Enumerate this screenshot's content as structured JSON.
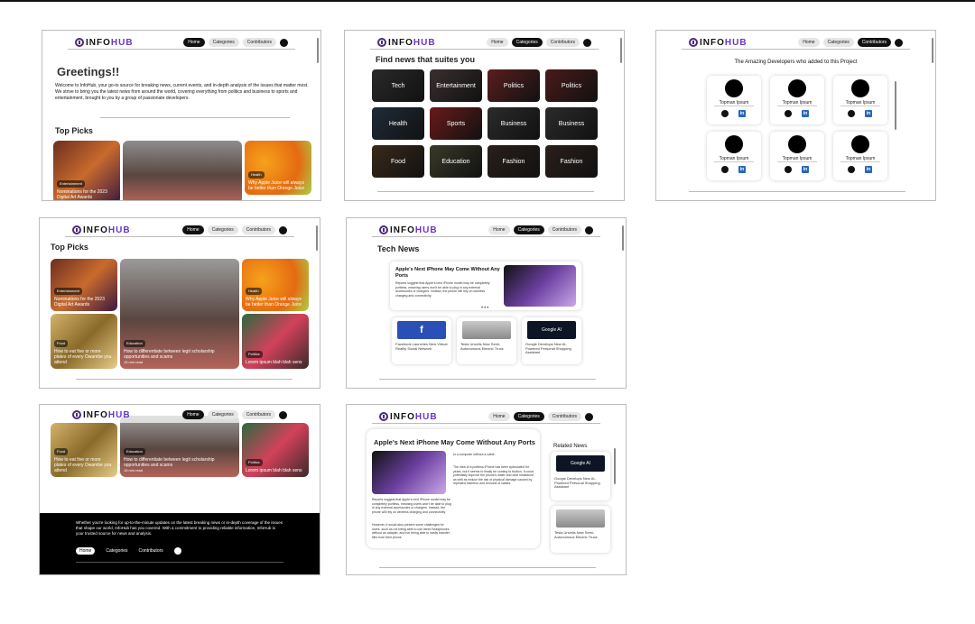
{
  "brand": {
    "info": "INFO",
    "hub": "HUB"
  },
  "nav": {
    "home": "Home",
    "categories": "Categories",
    "contributors": "Contributors"
  },
  "home": {
    "greeting": "Greetings!!",
    "intro": "Welcome to InfoHub, your go-to source for breaking news, current events, and in-depth analysis of the issues that matter most. We strive to bring you the latest news from around the world, covering everything from politics and business to sports and entertainment, brought to you by a group of passionate developers."
  },
  "top_picks": {
    "title": "Top Picks",
    "cards": [
      {
        "tag": "Entertainment",
        "title": "Nominations for the 2023 Digital Art Awards"
      },
      {
        "tag": "Health",
        "title": "Why Apple Juice will always be better than Orange Juice"
      },
      {
        "tag": "Food",
        "title": "How to eat five or more plates of every Owambe you attend"
      },
      {
        "tag": "Education",
        "title": "How to differentiate between legit scholarship opportunities and scams",
        "meta": "15 min read"
      },
      {
        "tag": "Politics",
        "title": "Lorem ipsum blah blah sens"
      }
    ]
  },
  "categories": {
    "title": "Find news that suites you",
    "items": [
      "Tech",
      "Entertainment",
      "Politics",
      "Politics",
      "Health",
      "Sports",
      "Business",
      "Business",
      "Food",
      "Education",
      "Fashion",
      "Fashion"
    ]
  },
  "contributors": {
    "title": "The Amazing Developers who added to this Project",
    "names": [
      "Topman Ipsum",
      "Topman Ipsum",
      "Topman Ipsum",
      "Topman Ipsum",
      "Topman Ipsum",
      "Topman Ipsum"
    ]
  },
  "tech": {
    "title": "Tech News",
    "featured_title": "Apple's Next iPhone May Come Without Any Ports",
    "featured_body": "Reports suggest that Apple's next iPhone model may be completely portless, meaning users won't be able to plug in any external accessories or chargers. Instead, the phone will rely on wireless charging and connectivity.",
    "cards": [
      {
        "label": "Facebook Launches New Virtual Reality Social Network",
        "thumb": "f"
      },
      {
        "label": "Tesla Unveils New Semi-Autonomous Electric Truck",
        "thumb": ""
      },
      {
        "label": "Google Develops New AI-Powered Personal Shopping Assistant",
        "thumb": "Google AI"
      }
    ]
  },
  "footer": {
    "text": "Whether you're looking for up-to-the-minute updates on the latest breaking news or in-depth coverage of the issues that shape our world, InfoHub has you covered. With a commitment to providing reliable information, InfoHub is your trusted source for news and analysis.",
    "links": [
      "Home",
      "Categories",
      "Contributors"
    ]
  },
  "article": {
    "title": "Apple's Next iPhone May Come Without Any Ports",
    "p1": "Reports suggest that Apple's next iPhone model may be completely portless, meaning users won't be able to plug in any external accessories or chargers. Instead, the phone will rely on wireless charging and connectivity.",
    "p2": "However, it would also present some challenges for users, such as not being able to use wired headphones without an adapter, and not being able to easily transfer files from their phone",
    "side1": "to a computer without a cable.",
    "side2": "The idea of a portless iPhone has been speculated for years, but it seems to finally be coming to fruition. It could potentially improve the phone's water and dust resistance, as well as reduce the risk of physical damage caused by repeated insertion and removal of cables.",
    "related_title": "Related News",
    "related": [
      {
        "label": "Google Develops New AI-Powered Personal Shopping Assistant",
        "thumb": "Google AI"
      },
      {
        "label": "Tesla Unveils New Semi-Autonomous Electric Truck"
      }
    ]
  }
}
